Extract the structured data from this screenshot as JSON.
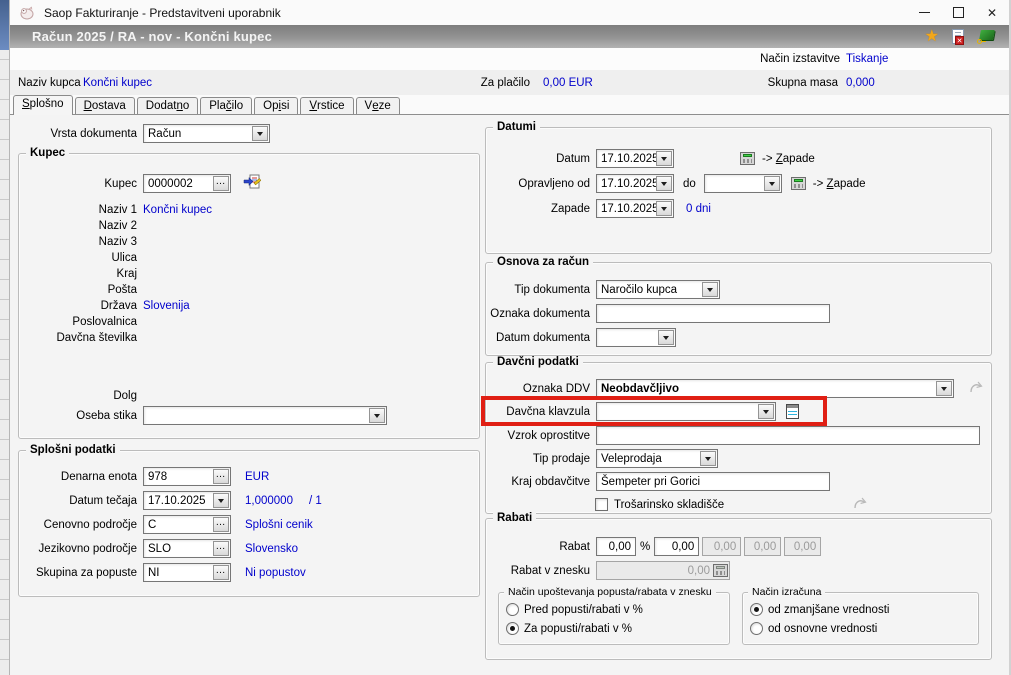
{
  "window": {
    "title": "Saop Fakturiranje - Predstavitveni uporabnik"
  },
  "header": {
    "title": "Račun  2025 / RA - nov - Končni kupec"
  },
  "info": {
    "nacin_label": "Način izstavitve",
    "nacin_value": "Tiskanje",
    "naziv_label": "Naziv kupca",
    "naziv_value": "Končni kupec",
    "placilo_label": "Za plačilo",
    "placilo_value": "0,00 EUR",
    "masa_label": "Skupna masa",
    "masa_value": "0,000"
  },
  "tabs": [
    {
      "pre": "",
      "u": "S",
      "post": "plošno",
      "active": true
    },
    {
      "pre": "",
      "u": "D",
      "post": "ostava",
      "active": false
    },
    {
      "pre": "Dodat",
      "u": "n",
      "post": "o",
      "active": false
    },
    {
      "pre": "Pla",
      "u": "č",
      "post": "ilo",
      "active": false
    },
    {
      "pre": "Op",
      "u": "i",
      "post": "si",
      "active": false
    },
    {
      "pre": "",
      "u": "V",
      "post": "rstice",
      "active": false
    },
    {
      "pre": "V",
      "u": "e",
      "post": "ze",
      "active": false
    }
  ],
  "form": {
    "vrsta_label": "Vrsta dokumenta",
    "vrsta_value": "Račun"
  },
  "kupec": {
    "title": "Kupec",
    "kupec_label": "Kupec",
    "kupec_value": "0000002",
    "naziv1_label": "Naziv 1",
    "naziv1_value": "Končni kupec",
    "naziv2_label": "Naziv 2",
    "naziv2_value": "",
    "naziv3_label": "Naziv 3",
    "naziv3_value": "",
    "ulica_label": "Ulica",
    "ulica_value": "",
    "kraj_label": "Kraj",
    "kraj_value": "",
    "posta_label": "Pošta",
    "posta_value": "",
    "drzava_label": "Država",
    "drzava_value": "Slovenija",
    "poslovalnica_label": "Poslovalnica",
    "poslovalnica_value": "",
    "davcna_label": "Davčna številka",
    "davcna_value": "",
    "dolg_label": "Dolg",
    "dolg_value": "",
    "oseba_label": "Oseba stika",
    "oseba_value": ""
  },
  "splosni": {
    "title": "Splošni podatki",
    "denarna_label": "Denarna enota",
    "denarna_value": "978",
    "denarna_info": "EUR",
    "tecaj_label": "Datum tečaja",
    "tecaj_value": "17.10.2025",
    "tecaj_info": "1,000000",
    "tecaj_ratio": "/ 1",
    "cenovno_label": "Cenovno področje",
    "cenovno_value": "C",
    "cenovno_info": "Splošni cenik",
    "jezik_label": "Jezikovno področje",
    "jezik_value": "SLO",
    "jezik_info": "Slovensko",
    "skupina_label": "Skupina za popuste",
    "skupina_value": "NI",
    "skupina_info": "Ni popustov"
  },
  "datumi": {
    "title": "Datumi",
    "datum_label": "Datum",
    "datum_value": "17.10.2025",
    "zapade_link": {
      "pre": "-> ",
      "u": "Z",
      "post": "apade"
    },
    "opravljeno_label": "Opravljeno od",
    "opravljeno_value": "17.10.2025",
    "do_label": "do",
    "do_value": "",
    "zapade_label": "Zapade",
    "zapade_value": "17.10.2025",
    "dni_value": "0 dni"
  },
  "osnova": {
    "title": "Osnova za račun",
    "tip_label": "Tip dokumenta",
    "tip_value": "Naročilo kupca",
    "oznaka_label": "Oznaka dokumenta",
    "oznaka_value": "",
    "datum_label": "Datum dokumenta",
    "datum_value": ""
  },
  "davcni": {
    "title": "Davčni podatki",
    "ddv_label": "Oznaka DDV",
    "ddv_value": "Neobdavčljivo",
    "klavzula_label": "Davčna klavzula",
    "klavzula_value": "",
    "vzrok_label": "Vzrok oprostitve",
    "vzrok_value": "",
    "tip_prodaje_label": "Tip prodaje",
    "tip_prodaje_value": "Veleprodaja",
    "kraj_label": "Kraj obdavčitve",
    "kraj_value": "Šempeter pri Gorici",
    "trosarinsko_label": "Trošarinsko skladišče"
  },
  "rabati": {
    "title": "Rabati",
    "rabat_label": "Rabat",
    "percent": "%",
    "values": [
      "0,00",
      "0,00",
      "0,00",
      "0,00",
      "0,00"
    ],
    "znesek_label": "Rabat v znesku",
    "znesek_value": "0,00",
    "nacin1": {
      "title": "Način upoštevanja popusta/rabata v znesku",
      "opt1": "Pred popusti/rabati v %",
      "opt1_selected": false,
      "opt2": "Za popusti/rabati v %",
      "opt2_selected": true
    },
    "nacin2": {
      "title": "Način izračuna",
      "opt1": "od zmanjšane vrednosti",
      "opt1_selected": true,
      "opt2": "od osnovne vrednosti",
      "opt2_selected": false
    }
  },
  "icons": {
    "favorite": "star",
    "close_document": "document-with-red-x",
    "help_book": "green-book-with-key",
    "calculator": "calculator",
    "notes": "notepad",
    "jump": "curved-gray-arrow",
    "edit_customer": "document-with-arrow-and-pencil"
  },
  "colors": {
    "value_blue": "#0000cc",
    "annotation_red": "#e01f14",
    "caption_gray": "#8f8f8f"
  }
}
